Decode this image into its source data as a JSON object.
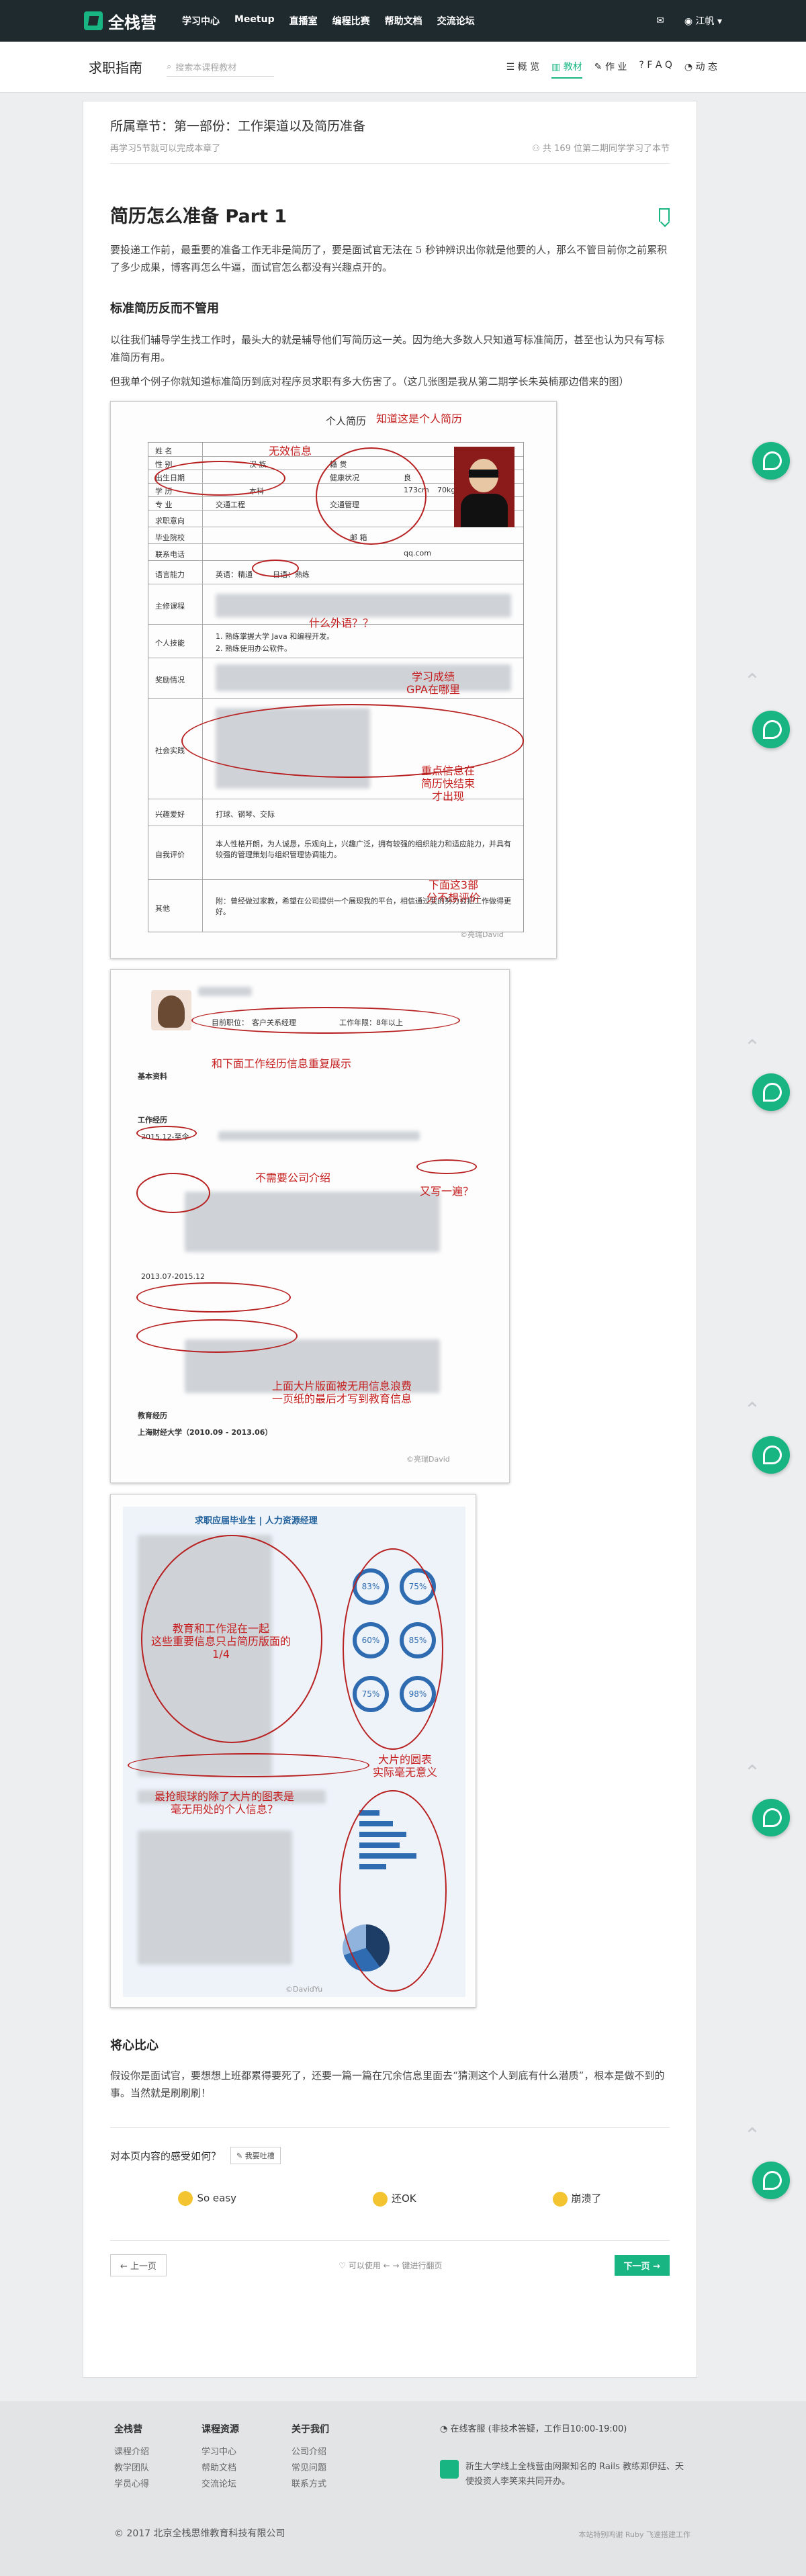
{
  "nav": {
    "logo": "全栈营",
    "links": [
      "学习中心",
      "Meetup",
      "直播室",
      "编程比赛",
      "帮助文档",
      "交流论坛"
    ],
    "mail_icon": "mail-icon",
    "user": "江帆"
  },
  "subnav": {
    "title": "求职指南",
    "search_placeholder": "搜索本课程教材",
    "tabs": [
      {
        "icon": "☰",
        "label": "概 览"
      },
      {
        "icon": "▥",
        "label": "教材"
      },
      {
        "icon": "✎",
        "label": "作 业"
      },
      {
        "icon": "?",
        "label": "F A Q"
      },
      {
        "icon": "◔",
        "label": "动 态"
      }
    ]
  },
  "chapter": {
    "title": "所属章节：第一部份：工作渠道以及简历准备",
    "progress": "再学习5节就可以完成本章了",
    "stats": "共 169 位第二期同学学习了本节"
  },
  "lesson": {
    "title": "简历怎么准备 Part 1",
    "intro": "要投递工作前，最重要的准备工作无非是简历了，要是面试官无法在 5 秒钟辨识出你就是他要的人，那么不管目前你之前累积了多少成果，博客再怎么牛逼，面试官怎么都没有兴趣点开的。",
    "h1": "标准简历反而不管用",
    "p2": "以往我们辅导学生找工作时，最头大的就是辅导他们写简历这一关。因为绝大多数人只知道写标准简历，甚至也认为只有写标准简历有用。",
    "p3": "但我单个例子你就知道标准简历到底对程序员求职有多大伤害了。（这几张图是我从第二期学长朱英楠那边借来的图）",
    "h2": "将心比心",
    "p4": "假设你是面试官，要想想上班都累得要死了，还要一篇一篇在冗余信息里面去“猜测这个人到底有什么潜质”，根本是做不到的事。当然就是刷刷刷！"
  },
  "resume1": {
    "heading": "个人简历",
    "labels": [
      "姓 名",
      "性 别",
      "出生日期",
      "学 历",
      "专 业",
      "求职意向",
      "毕业院校",
      "联系电话",
      "语言能力",
      "主修课程",
      "个人技能",
      "奖励情况",
      "社会实践",
      "兴趣爱好",
      "自我评价",
      "其他"
    ],
    "cells": [
      "汉 族",
      "籍 贯",
      "健康状况",
      "良",
      "本科",
      "173cm",
      "70kg",
      "交通工程",
      "交通管理",
      "毕业院校",
      "邮 箱",
      "qq.com",
      "英语：精通",
      "日语：熟练",
      "1. 熟练掌握大学 Java 和编程开发。",
      "2. 熟练使用办公软件。",
      "打球、钢琴、交际"
    ],
    "self_eval": "本人性格开朗，为人诚恳，乐观向上，兴趣广泛，拥有较强的组织能力和适应能力，并具有较强的管理策划与组织管理协调能力。",
    "other": "附：曾经做过家教，希望在公司提供一个展现我的平台，相信通过我的努力会把工作做得更好。",
    "annotations": [
      "知道这是个人简历",
      "无效信息",
      "什么外语？？",
      "学习成绩\nGPA在哪里",
      "重点信息在\n简历快结束\n才出现",
      "下面这3部\n分不想评价"
    ],
    "watermark": "©亮瑞David"
  },
  "resume2": {
    "fields": [
      "目前职位：",
      "客户关系经理",
      "工作年限：",
      "8年以上"
    ],
    "sections": [
      "基本资料",
      "工作经历",
      "教育经历"
    ],
    "entries": [
      "2015.12-至今",
      "2013.07-2015.12",
      "上海财经大学（2010.09 - 2013.06）"
    ],
    "annotations": [
      "和下面工作经历信息重复展示",
      "不需要公司介绍",
      "又写一遍？",
      "上面大片版面被无用信息浪费\n一页纸的最后才写到教育信息"
    ],
    "watermark": "©亮瑞David"
  },
  "resume3": {
    "heading": "求职应届毕业生 | 人力资源经理",
    "percents": [
      "83%",
      "75%",
      "60%",
      "85%",
      "75%",
      "98%"
    ],
    "annotations": [
      "教育和工作混在一起\n这些重要信息只占简历版面的\n1/4",
      "大片的圆表\n实际毫无意义",
      "最抢眼球的除了大片的图表是\n毫无用处的个人信息？"
    ],
    "watermark": "©DavidYu"
  },
  "feedback": {
    "question": "对本页内容的感受如何？",
    "btn": "我要吐槽",
    "options": [
      "So easy",
      "还OK",
      "崩溃了"
    ]
  },
  "pager": {
    "prev": "上一页",
    "hint": "可以使用 ← → 键进行翻页",
    "next": "下一页"
  },
  "footer": {
    "cols": [
      {
        "title": "全栈营",
        "items": [
          "课程介绍",
          "教学团队",
          "学员心得"
        ]
      },
      {
        "title": "课程资源",
        "items": [
          "学习中心",
          "帮助文档",
          "交流论坛"
        ]
      },
      {
        "title": "关于我们",
        "items": [
          "公司介绍",
          "常见问题",
          "联系方式"
        ]
      }
    ],
    "service": "在线客服 (非技术答疑，工作日10:00-19:00)",
    "brand": "新生大学线上全栈营由网聚知名的 Rails 教练郑伊廷、天使投资人李笑来共同开办。",
    "copyright": "© 2017 北京全栈思维教育科技有限公司",
    "icp": "本站特别鸣谢 Ruby 飞速搭建工作"
  },
  "colors": {
    "brand": "#18b582",
    "annotation": "#c51e1e",
    "nav_bg": "#1f2a2f"
  }
}
